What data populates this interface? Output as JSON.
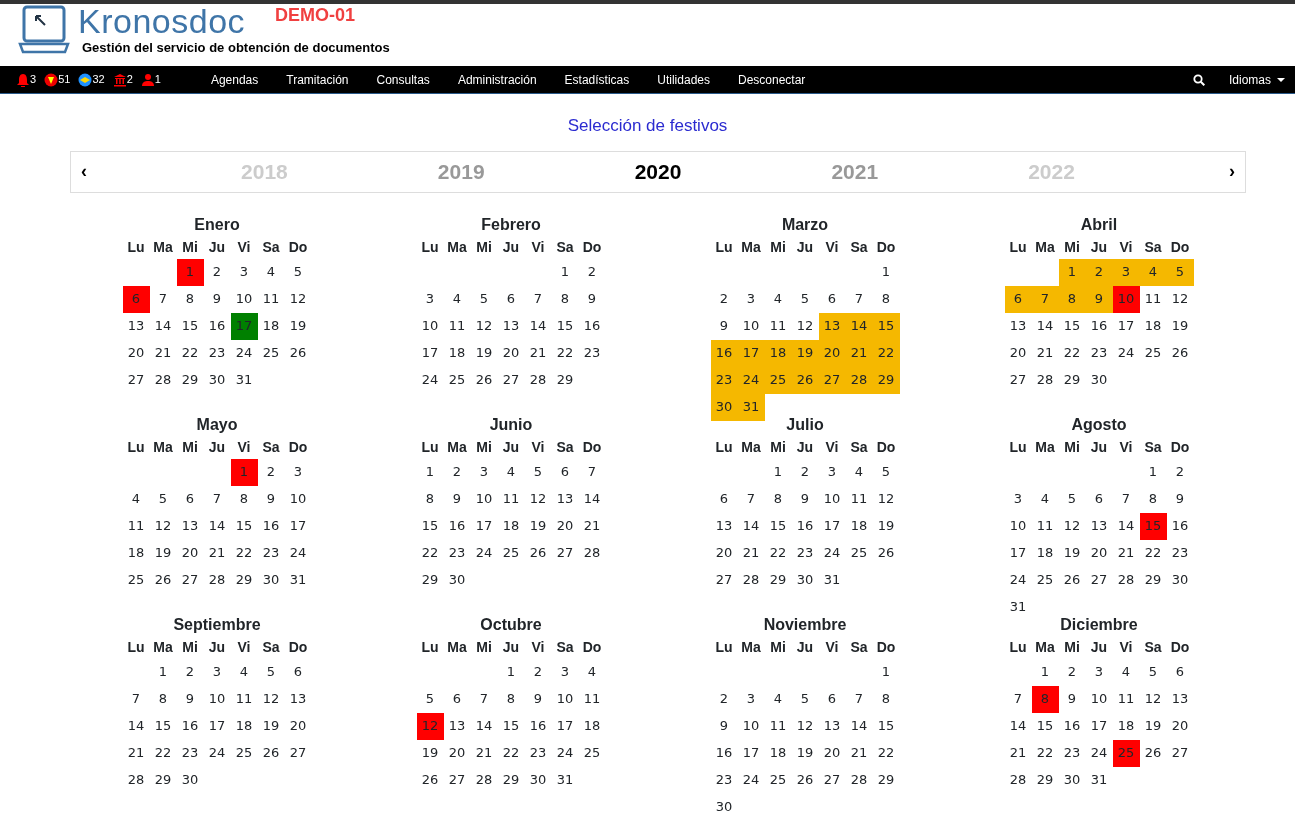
{
  "brand": {
    "name": "Kronosdoc",
    "subtitle": "Gestión del servicio de obtención de documentos",
    "instance": "DEMO-01"
  },
  "counters": [
    {
      "kind": "bell",
      "count": "3"
    },
    {
      "kind": "shield",
      "count": "51"
    },
    {
      "kind": "disc",
      "count": "32"
    },
    {
      "kind": "bank",
      "count": "2"
    },
    {
      "kind": "person",
      "count": "1"
    }
  ],
  "menu": [
    "Agendas",
    "Tramitación",
    "Consultas",
    "Administración",
    "Estadísticas",
    "Utilidades",
    "Desconectar"
  ],
  "languages": "Idiomas",
  "page_title": "Selección de festivos",
  "year_nav": {
    "prev": "‹",
    "next": "›",
    "years": [
      {
        "label": "2018",
        "selected": false
      },
      {
        "label": "2019",
        "selected": false
      },
      {
        "label": "2020",
        "selected": true
      },
      {
        "label": "2021",
        "selected": false
      },
      {
        "label": "2022",
        "selected": false
      }
    ]
  },
  "months": [
    {
      "name": "Enero",
      "weekdays": [
        "Lu",
        "Ma",
        "Mi",
        "Ju",
        "Vi",
        "Sa",
        "Do"
      ],
      "weeks": [
        [
          {
            "day": "1",
            "color": "#ff0000"
          },
          "2",
          "3",
          "4",
          "5"
        ],
        [
          {
            "day": "6",
            "color": "#ff0000"
          },
          "7",
          "8",
          "9",
          "10",
          "11",
          "12"
        ],
        [
          "13",
          "14",
          "15",
          "16",
          {
            "day": "17",
            "color": "#008000"
          },
          "18",
          "19"
        ],
        [
          "20",
          "21",
          "22",
          "23",
          "24",
          "25",
          "26"
        ],
        [
          "27",
          "28",
          "29",
          "30",
          "31"
        ]
      ]
    },
    {
      "name": "Febrero",
      "weekdays": [
        "Lu",
        "Ma",
        "Mi",
        "Ju",
        "Vi",
        "Sa",
        "Do"
      ],
      "weeks": [
        [
          "1",
          "2"
        ],
        [
          "3",
          "4",
          "5",
          "6",
          "7",
          "8",
          "9"
        ],
        [
          "10",
          "11",
          "12",
          "13",
          "14",
          "15",
          "16"
        ],
        [
          "17",
          "18",
          "19",
          "20",
          "21",
          "22",
          "23"
        ],
        [
          "24",
          "25",
          "26",
          "27",
          "28",
          "29"
        ]
      ]
    },
    {
      "name": "Marzo",
      "weekdays": [
        "Lu",
        "Ma",
        "Mi",
        "Ju",
        "Vi",
        "Sa",
        "Do"
      ],
      "weeks": [
        [
          "1"
        ],
        [
          "2",
          "3",
          "4",
          "5",
          "6",
          "7",
          "8"
        ],
        [
          "9",
          "10",
          "11",
          "12",
          {
            "day": "13",
            "color": "#f5b800"
          },
          {
            "day": "14",
            "color": "#f5b800"
          },
          {
            "day": "15",
            "color": "#f5b800"
          }
        ],
        [
          {
            "day": "16",
            "color": "#f5b800"
          },
          {
            "day": "17",
            "color": "#f5b800"
          },
          {
            "day": "18",
            "color": "#f5b800"
          },
          {
            "day": "19",
            "color": "#f5b800"
          },
          {
            "day": "20",
            "color": "#f5b800"
          },
          {
            "day": "21",
            "color": "#f5b800"
          },
          {
            "day": "22",
            "color": "#f5b800"
          }
        ],
        [
          {
            "day": "23",
            "color": "#f5b800"
          },
          {
            "day": "24",
            "color": "#f5b800"
          },
          {
            "day": "25",
            "color": "#f5b800"
          },
          {
            "day": "26",
            "color": "#f5b800"
          },
          {
            "day": "27",
            "color": "#f5b800"
          },
          {
            "day": "28",
            "color": "#f5b800"
          },
          {
            "day": "29",
            "color": "#f5b800"
          }
        ],
        [
          {
            "day": "30",
            "color": "#f5b800"
          },
          {
            "day": "31",
            "color": "#f5b800"
          }
        ]
      ]
    },
    {
      "name": "Abril",
      "weekdays": [
        "Lu",
        "Ma",
        "Mi",
        "Ju",
        "Vi",
        "Sa",
        "Do"
      ],
      "weeks": [
        [
          {
            "day": "1",
            "color": "#f5b800"
          },
          {
            "day": "2",
            "color": "#f5b800"
          },
          {
            "day": "3",
            "color": "#f5b800"
          },
          {
            "day": "4",
            "color": "#f5b800"
          },
          {
            "day": "5",
            "color": "#f5b800"
          }
        ],
        [
          {
            "day": "6",
            "color": "#f5b800"
          },
          {
            "day": "7",
            "color": "#f5b800"
          },
          {
            "day": "8",
            "color": "#f5b800"
          },
          {
            "day": "9",
            "color": "#f5b800"
          },
          {
            "day": "10",
            "color": "#ff0000"
          },
          "11",
          "12"
        ],
        [
          "13",
          "14",
          "15",
          "16",
          "17",
          "18",
          "19"
        ],
        [
          "20",
          "21",
          "22",
          "23",
          "24",
          "25",
          "26"
        ],
        [
          "27",
          "28",
          "29",
          "30"
        ]
      ]
    },
    {
      "name": "Mayo",
      "weekdays": [
        "Lu",
        "Ma",
        "Mi",
        "Ju",
        "Vi",
        "Sa",
        "Do"
      ],
      "weeks": [
        [
          {
            "day": "1",
            "color": "#ff0000"
          },
          "2",
          "3"
        ],
        [
          "4",
          "5",
          "6",
          "7",
          "8",
          "9",
          "10"
        ],
        [
          "11",
          "12",
          "13",
          "14",
          "15",
          "16",
          "17"
        ],
        [
          "18",
          "19",
          "20",
          "21",
          "22",
          "23",
          "24"
        ],
        [
          "25",
          "26",
          "27",
          "28",
          "29",
          "30",
          "31"
        ]
      ]
    },
    {
      "name": "Junio",
      "weekdays": [
        "Lu",
        "Ma",
        "Mi",
        "Ju",
        "Vi",
        "Sa",
        "Do"
      ],
      "weeks": [
        [
          "1",
          "2",
          "3",
          "4",
          "5",
          "6",
          "7"
        ],
        [
          "8",
          "9",
          "10",
          "11",
          "12",
          "13",
          "14"
        ],
        [
          "15",
          "16",
          "17",
          "18",
          "19",
          "20",
          "21"
        ],
        [
          "22",
          "23",
          "24",
          "25",
          "26",
          "27",
          "28"
        ],
        [
          "29",
          "30"
        ]
      ]
    },
    {
      "name": "Julio",
      "weekdays": [
        "Lu",
        "Ma",
        "Mi",
        "Ju",
        "Vi",
        "Sa",
        "Do"
      ],
      "weeks": [
        [
          "1",
          "2",
          "3",
          "4",
          "5"
        ],
        [
          "6",
          "7",
          "8",
          "9",
          "10",
          "11",
          "12"
        ],
        [
          "13",
          "14",
          "15",
          "16",
          "17",
          "18",
          "19"
        ],
        [
          "20",
          "21",
          "22",
          "23",
          "24",
          "25",
          "26"
        ],
        [
          "27",
          "28",
          "29",
          "30",
          "31"
        ]
      ]
    },
    {
      "name": "Agosto",
      "weekdays": [
        "Lu",
        "Ma",
        "Mi",
        "Ju",
        "Vi",
        "Sa",
        "Do"
      ],
      "weeks": [
        [
          "1",
          "2"
        ],
        [
          "3",
          "4",
          "5",
          "6",
          "7",
          "8",
          "9"
        ],
        [
          "10",
          "11",
          "12",
          "13",
          "14",
          {
            "day": "15",
            "color": "#ff0000"
          },
          "16"
        ],
        [
          "17",
          "18",
          "19",
          "20",
          "21",
          "22",
          "23"
        ],
        [
          "24",
          "25",
          "26",
          "27",
          "28",
          "29",
          "30"
        ],
        [
          "31"
        ]
      ]
    },
    {
      "name": "Septiembre",
      "weekdays": [
        "Lu",
        "Ma",
        "Mi",
        "Ju",
        "Vi",
        "Sa",
        "Do"
      ],
      "weeks": [
        [
          "1",
          "2",
          "3",
          "4",
          "5",
          "6"
        ],
        [
          "7",
          "8",
          "9",
          "10",
          "11",
          "12",
          "13"
        ],
        [
          "14",
          "15",
          "16",
          "17",
          "18",
          "19",
          "20"
        ],
        [
          "21",
          "22",
          "23",
          "24",
          "25",
          "26",
          "27"
        ],
        [
          "28",
          "29",
          "30"
        ]
      ]
    },
    {
      "name": "Octubre",
      "weekdays": [
        "Lu",
        "Ma",
        "Mi",
        "Ju",
        "Vi",
        "Sa",
        "Do"
      ],
      "weeks": [
        [
          "1",
          "2",
          "3",
          "4"
        ],
        [
          "5",
          "6",
          "7",
          "8",
          "9",
          "10",
          "11"
        ],
        [
          {
            "day": "12",
            "color": "#ff0000"
          },
          "13",
          "14",
          "15",
          "16",
          "17",
          "18"
        ],
        [
          "19",
          "20",
          "21",
          "22",
          "23",
          "24",
          "25"
        ],
        [
          "26",
          "27",
          "28",
          "29",
          "30",
          "31"
        ]
      ]
    },
    {
      "name": "Noviembre",
      "weekdays": [
        "Lu",
        "Ma",
        "Mi",
        "Ju",
        "Vi",
        "Sa",
        "Do"
      ],
      "weeks": [
        [
          "1"
        ],
        [
          "2",
          "3",
          "4",
          "5",
          "6",
          "7",
          "8"
        ],
        [
          "9",
          "10",
          "11",
          "12",
          "13",
          "14",
          "15"
        ],
        [
          "16",
          "17",
          "18",
          "19",
          "20",
          "21",
          "22"
        ],
        [
          "23",
          "24",
          "25",
          "26",
          "27",
          "28",
          "29"
        ],
        [
          "30"
        ]
      ]
    },
    {
      "name": "Diciembre",
      "weekdays": [
        "Lu",
        "Ma",
        "Mi",
        "Ju",
        "Vi",
        "Sa",
        "Do"
      ],
      "weeks": [
        [
          "1",
          "2",
          "3",
          "4",
          "5",
          "6"
        ],
        [
          "7",
          {
            "day": "8",
            "color": "#ff0000"
          },
          "9",
          "10",
          "11",
          "12",
          "13"
        ],
        [
          "14",
          "15",
          "16",
          "17",
          "18",
          "19",
          "20"
        ],
        [
          "21",
          "22",
          "23",
          "24",
          {
            "day": "25",
            "color": "#ff0000"
          },
          "26",
          "27"
        ],
        [
          "28",
          "29",
          "30",
          "31"
        ]
      ]
    }
  ]
}
